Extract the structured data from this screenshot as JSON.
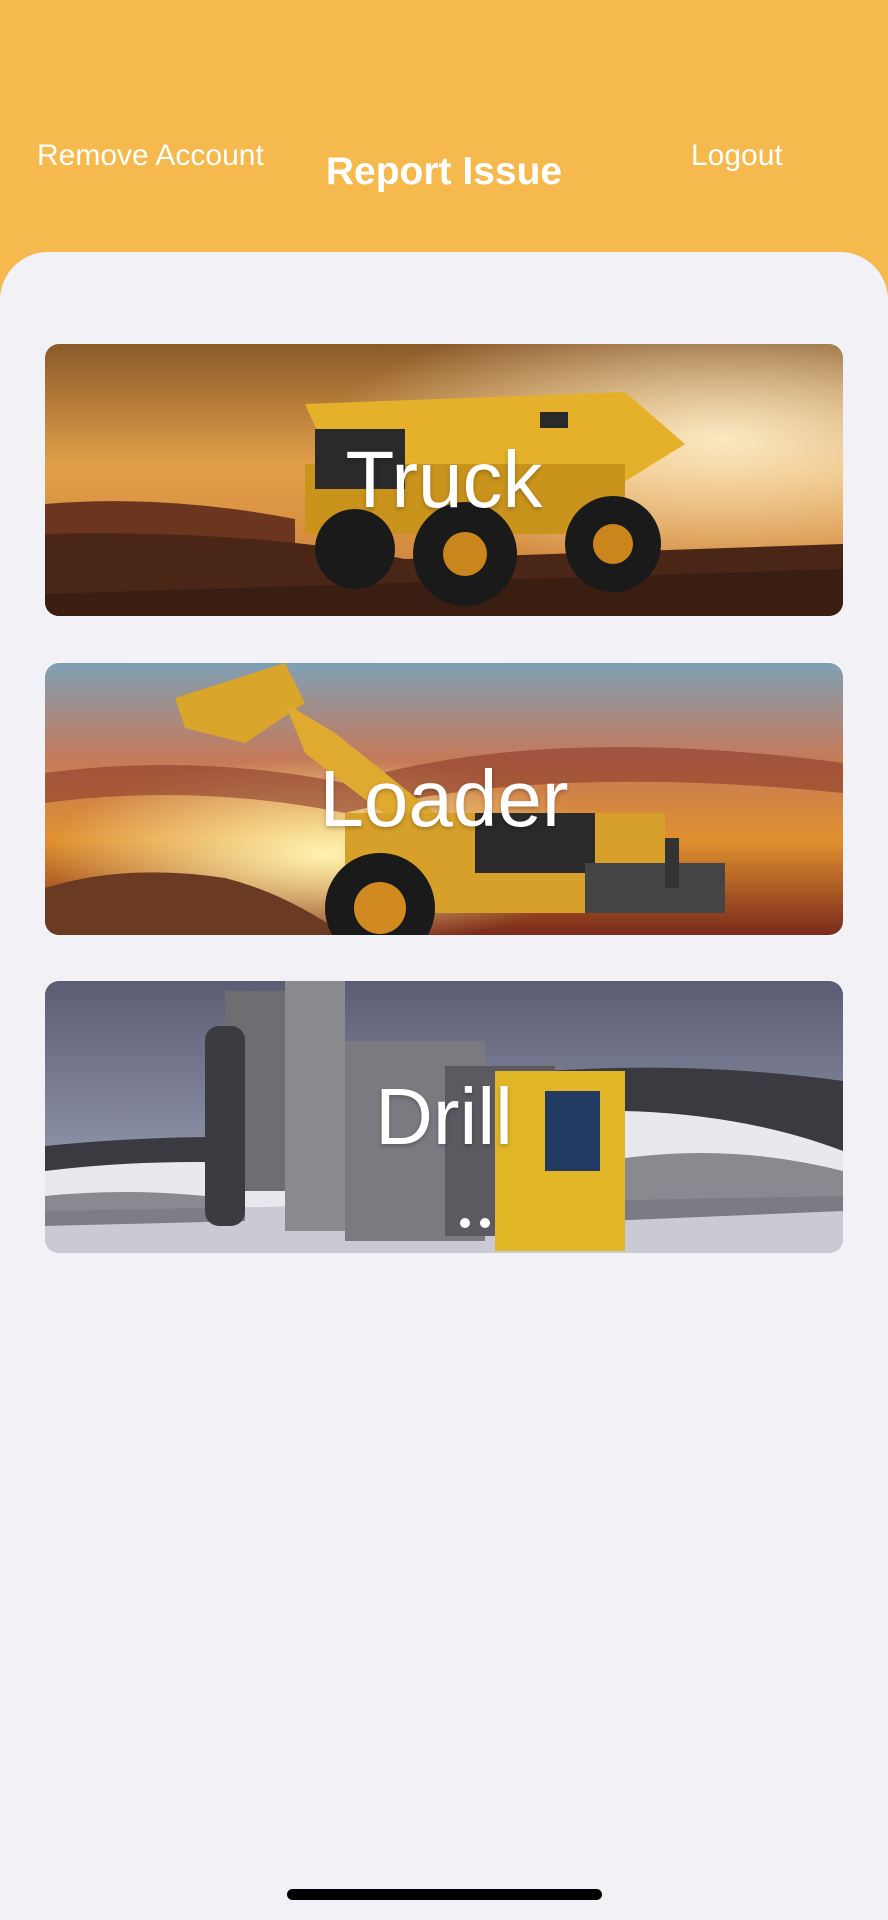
{
  "header": {
    "left_action": "Remove Account",
    "title": "Report Issue",
    "right_action": "Logout",
    "background_color": "#f5b94d"
  },
  "categories": [
    {
      "label": "Truck"
    },
    {
      "label": "Loader"
    },
    {
      "label": "Drill"
    }
  ],
  "colors": {
    "content_background": "#f2f1f6",
    "label_text": "#ffffff"
  }
}
